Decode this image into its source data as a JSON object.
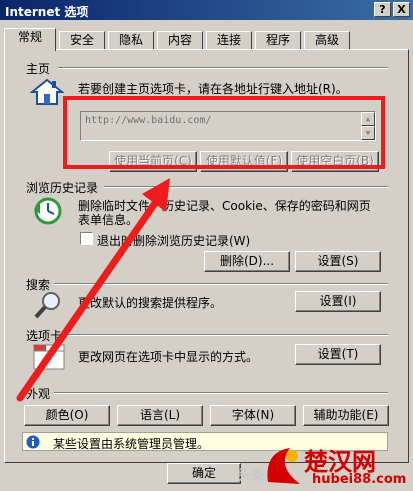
{
  "window": {
    "title": "Internet 选项",
    "help_btn": "?",
    "close_btn": "X"
  },
  "tabs": [
    "常规",
    "安全",
    "隐私",
    "内容",
    "连接",
    "程序",
    "高级"
  ],
  "home": {
    "section": "主页",
    "desc": "若要创建主页选项卡，请在各地址行键入地址(R)。",
    "address": "http://www.baidu.com/",
    "btn_current": "使用当前页(C)",
    "btn_default": "使用默认值(F)",
    "btn_blank": "使用空白页(B)"
  },
  "history": {
    "section": "浏览历史记录",
    "desc_line1": "删除临时文件、历史记录、Cookie、保存的密码和网页",
    "desc_line2": "表单信息。",
    "checkbox_label": "退出时删除浏览历史记录(W)",
    "btn_delete": "删除(D)...",
    "btn_settings": "设置(S)"
  },
  "search": {
    "section": "搜索",
    "desc": "更改默认的搜索提供程序。",
    "btn_settings": "设置(I)"
  },
  "tabs_section": {
    "section": "选项卡",
    "desc": "更改网页在选项卡中显示的方式。",
    "btn_settings": "设置(T)"
  },
  "appearance": {
    "section": "外观",
    "btn_colors": "颜色(O)",
    "btn_languages": "语言(L)",
    "btn_fonts": "字体(N)",
    "btn_accessibility": "辅助功能(E)"
  },
  "info": {
    "icon": "info-icon",
    "text": "某些设置由系统管理员管理。"
  },
  "footer": {
    "btn_ok": "确定"
  },
  "watermark": {
    "text_left": "头条",
    "text_brand": "楚汉网",
    "text_url": "hubei88.com"
  },
  "colors": {
    "annotation": "#ee1c1c",
    "title_start": "#0a246a",
    "title_end": "#3a6ea5"
  }
}
